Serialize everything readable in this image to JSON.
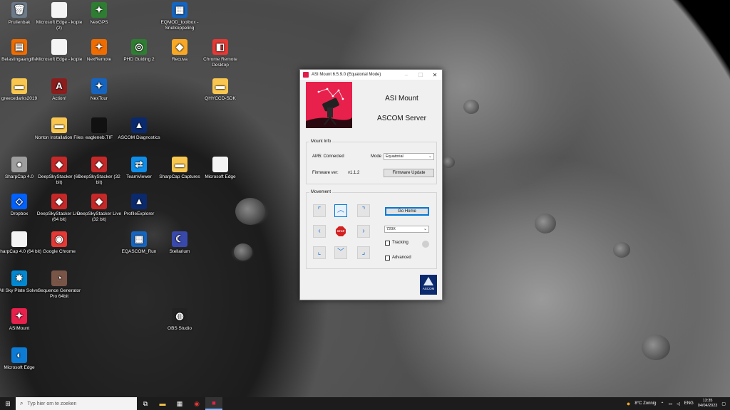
{
  "desktop": {
    "icons": [
      {
        "label": "Prullenbak",
        "glyph": "🗑",
        "color": "#6c7a89"
      },
      {
        "label": "Microsoft Edge - kopie (2)",
        "glyph": "",
        "color": "#f4f4f4"
      },
      {
        "label": "NexGPS",
        "glyph": "✦",
        "color": "#2e7d32"
      },
      {
        "label": "EQMOD_toolbox - Snelkoppeling",
        "glyph": "▦",
        "color": "#1565c0"
      },
      {
        "label": "Belastingaangifte",
        "glyph": "▤",
        "color": "#ef6c00"
      },
      {
        "label": "Microsoft Edge - kopie",
        "glyph": "",
        "color": "#f4f4f4"
      },
      {
        "label": "NexRemote",
        "glyph": "✦",
        "color": "#ef6c00"
      },
      {
        "label": "PHD Guiding 2",
        "glyph": "◎",
        "color": "#2e7d32"
      },
      {
        "label": "Recuva",
        "glyph": "◆",
        "color": "#f9a825"
      },
      {
        "label": "Chrome Remote Desktop",
        "glyph": "◧",
        "color": "#e53935"
      },
      {
        "label": "greecedarks2019",
        "glyph": "▬",
        "color": "#f9c74f"
      },
      {
        "label": "Action!",
        "glyph": "A",
        "color": "#8b1d1d"
      },
      {
        "label": "NexTour",
        "glyph": "✦",
        "color": "#1565c0"
      },
      {
        "label": "QHYCCD-SDK",
        "glyph": "▬",
        "color": "#f9c74f"
      },
      {
        "label": "Norton Installation Files",
        "glyph": "▬",
        "color": "#f9c74f"
      },
      {
        "label": "eagleneb.TIF",
        "glyph": "",
        "color": "#111111"
      },
      {
        "label": "ASCOM Diagnostics",
        "glyph": "▲",
        "color": "#0b2a6e"
      },
      {
        "label": "SharpCap 4.0",
        "glyph": "●",
        "color": "#9e9e9e"
      },
      {
        "label": "DeepSkyStacker (64 bit)",
        "glyph": "◆",
        "color": "#c62828"
      },
      {
        "label": "DeepSkyStacker (32 bit)",
        "glyph": "◆",
        "color": "#c62828"
      },
      {
        "label": "TeamViewer",
        "glyph": "⇄",
        "color": "#0e8ee9"
      },
      {
        "label": "SharpCap Captures",
        "glyph": "▬",
        "color": "#f9c74f"
      },
      {
        "label": "Microsoft Edge",
        "glyph": "",
        "color": "#f4f4f4"
      },
      {
        "label": "Dropbox",
        "glyph": "◇",
        "color": "#0061fe"
      },
      {
        "label": "DeepSkyStacker Live (64 bit)",
        "glyph": "◆",
        "color": "#c62828"
      },
      {
        "label": "DeepSkyStacker Live (32 bit)",
        "glyph": "◆",
        "color": "#c62828"
      },
      {
        "label": "ProfileExplorer",
        "glyph": "▲",
        "color": "#0b2a6e"
      },
      {
        "label": "SharpCap 4.0 (64 bit)",
        "glyph": "",
        "color": "#f4f4f4"
      },
      {
        "label": "Google Chrome",
        "glyph": "◉",
        "color": "#e53935"
      },
      {
        "label": "EQASCOM_Run",
        "glyph": "▦",
        "color": "#1565c0"
      },
      {
        "label": "Stellarium",
        "glyph": "☾",
        "color": "#3949ab"
      },
      {
        "label": "All Sky Plate Solver",
        "glyph": "✸",
        "color": "#0288d1"
      },
      {
        "label": "Sequence Generator Pro 64bit",
        "glyph": "◔",
        "color": "#795548"
      },
      {
        "label": "ASIMount",
        "glyph": "✦",
        "color": "#e8204c"
      },
      {
        "label": "OBS Studio",
        "glyph": "◍",
        "color": "#222222"
      },
      {
        "label": "Microsoft Edge",
        "glyph": "◐",
        "color": "#0c7bd6"
      }
    ]
  },
  "window": {
    "title": "ASI Mount 6.5.9.0 (Equatorial Mode)",
    "heading1": "ASI Mount",
    "heading2": "ASCOM Server",
    "mount_info": {
      "group_title": "Mount Info",
      "status": "AM5: Connected",
      "mode_label": "Mode",
      "mode_value": "Equatorial",
      "firmware_label": "Firmware ver:",
      "firmware_value": "v1.1.2",
      "firmware_button": "Firmware Update"
    },
    "movement": {
      "group_title": "Movement",
      "go_home": "Go Home",
      "speed_value": "720X",
      "stop_label": "STOP",
      "tracking_label": "Tracking",
      "advanced_label": "Advanced"
    },
    "ascom_logo_text": "ASCOM"
  },
  "taskbar": {
    "search_placeholder": "Typ hier om te zoeken",
    "weather": "8°C  Zonnig",
    "lang": "ENG",
    "time": "13:35",
    "date": "04/04/2023"
  }
}
